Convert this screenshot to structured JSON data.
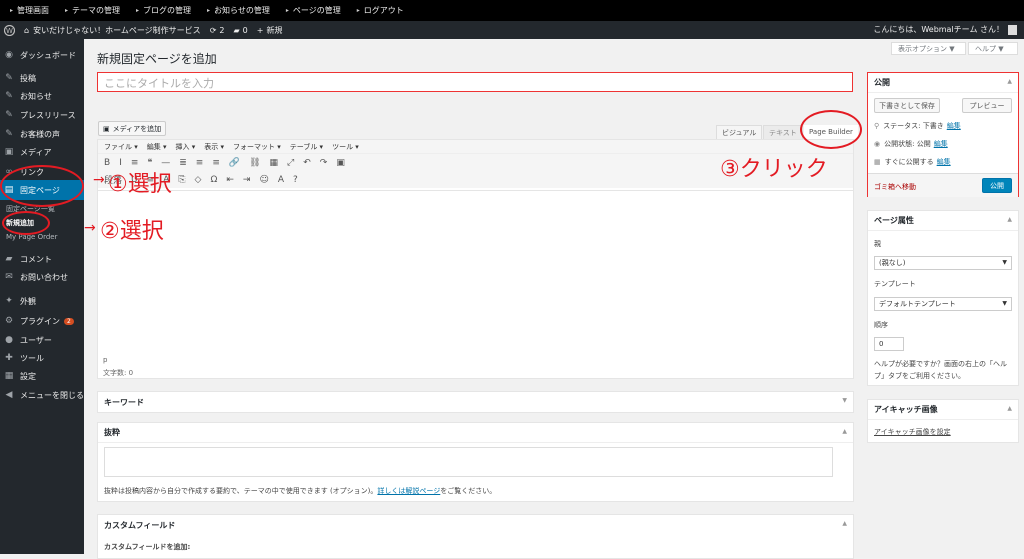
{
  "topbar": {
    "items": [
      "管理画面",
      "テーマの管理",
      "ブログの管理",
      "お知らせの管理",
      "ページの管理",
      "ログアウト"
    ]
  },
  "adminbar": {
    "site": "安いだけじゃない！ホームページ制作サービス",
    "updates": "2",
    "comments": "0",
    "new": "新規",
    "greeting": "こんにちは、Webmalチーム さん！"
  },
  "sidebar": {
    "items": [
      {
        "label": "ダッシュボード",
        "icon": "dashboard-icon",
        "glyph": "◉"
      },
      {
        "label": "投稿",
        "icon": "pin-icon",
        "glyph": "✎"
      },
      {
        "label": "お知らせ",
        "icon": "pin-icon",
        "glyph": "✎"
      },
      {
        "label": "プレスリリース",
        "icon": "pin-icon",
        "glyph": "✎"
      },
      {
        "label": "お客様の声",
        "icon": "pin-icon",
        "glyph": "✎"
      },
      {
        "label": "メディア",
        "icon": "media-icon",
        "glyph": "▣"
      },
      {
        "label": "リンク",
        "icon": "link-icon",
        "glyph": "∞"
      },
      {
        "label": "固定ページ",
        "icon": "page-icon",
        "glyph": "▤"
      },
      {
        "label": "コメント",
        "icon": "comment-icon",
        "glyph": "▰"
      },
      {
        "label": "お問い合わせ",
        "icon": "mail-icon",
        "glyph": "✉"
      },
      {
        "label": "外観",
        "icon": "appearance-icon",
        "glyph": "✦"
      },
      {
        "label": "プラグイン",
        "icon": "plugin-icon",
        "glyph": "⚙",
        "badge": "2"
      },
      {
        "label": "ユーザー",
        "icon": "user-icon",
        "glyph": "●"
      },
      {
        "label": "ツール",
        "icon": "tool-icon",
        "glyph": "✚"
      },
      {
        "label": "設定",
        "icon": "settings-icon",
        "glyph": "▦"
      },
      {
        "label": "メニューを閉じる",
        "icon": "collapse-icon",
        "glyph": "◀"
      }
    ],
    "sub": [
      "固定ページ一覧",
      "新規追加",
      "My Page Order"
    ]
  },
  "main": {
    "title": "新規固定ページを追加",
    "screen_options": "表示オプション ▼",
    "help": "ヘルプ ▼",
    "title_placeholder": "ここにタイトルを入力",
    "add_media": "メディアを追加",
    "tabs": [
      "ビジュアル",
      "テキスト",
      "Page Builder"
    ],
    "menubar": [
      "ファイル ▾",
      "編集 ▾",
      "挿入 ▾",
      "表示 ▾",
      "フォーマット ▾",
      "テーブル ▾",
      "ツール ▾"
    ],
    "toolbar1": [
      "B",
      "I",
      "≡",
      "❝",
      "—",
      "≣",
      "≡",
      "≡",
      "🔗",
      "⛓",
      "▦",
      "⤢",
      "↶",
      "↷",
      "▣"
    ],
    "toolbar2": [
      "段落",
      "U",
      "≡",
      "A",
      "⎘",
      "◇",
      "Ω",
      "⇤",
      "⇥",
      "☺",
      "A",
      "?"
    ],
    "path": "p",
    "wordcount": "文字数: 0"
  },
  "publish": {
    "title": "公開",
    "save_draft": "下書きとして保存",
    "preview": "プレビュー",
    "status_label": "ステータス: 下書き",
    "visibility_label": "公開状態: 公開",
    "schedule_label": "すぐに公開する",
    "edit": "編集",
    "trash": "ゴミ箱へ移動",
    "publish_btn": "公開"
  },
  "attributes": {
    "title": "ページ属性",
    "parent_label": "親",
    "parent_value": "(親なし)",
    "template_label": "テンプレート",
    "template_value": "デフォルトテンプレート",
    "order_label": "順序",
    "order_value": "0",
    "help_text1": "ヘルプが必要ですか？画面の右上の「ヘル",
    "help_text2": "プ」タブをご利用ください。"
  },
  "eyecatch": {
    "title": "アイキャッチ画像",
    "link": "アイキャッチ画像を設定"
  },
  "keyword": {
    "title": "キーワード"
  },
  "excerpt": {
    "title": "抜粋",
    "desc": "抜粋は投稿内容から自分で作成する要約で、テーマの中で使用できます (オプション)。",
    "link": "詳しくは解説ページ",
    "desc2": "をご覧ください。"
  },
  "custom": {
    "title": "カスタムフィールド",
    "add": "カスタムフィールドを追加:"
  },
  "annotations": {
    "a1": "①選択",
    "a2": "②選択",
    "a3": "③クリック"
  }
}
